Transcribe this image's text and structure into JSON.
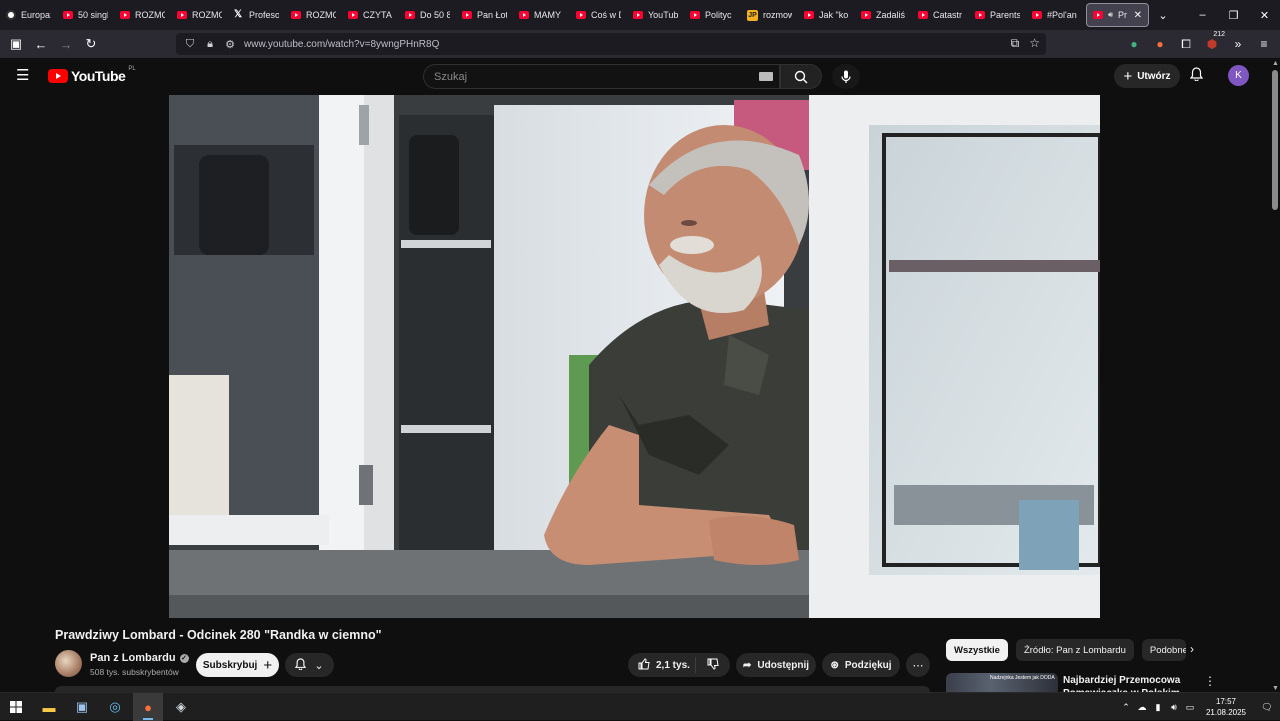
{
  "browser": {
    "tabs": [
      {
        "label": "Europa:",
        "icon": "globe-icon"
      },
      {
        "label": "50 singl",
        "icon": "youtube-icon"
      },
      {
        "label": "ROZMO",
        "icon": "youtube-icon"
      },
      {
        "label": "ROZMO",
        "icon": "youtube-icon"
      },
      {
        "label": "Profeso",
        "icon": "x-icon"
      },
      {
        "label": "ROZMO",
        "icon": "youtube-icon"
      },
      {
        "label": "CZYTA",
        "icon": "youtube-icon"
      },
      {
        "label": "Do 50 8",
        "icon": "youtube-icon"
      },
      {
        "label": "Pan Łot",
        "icon": "youtube-icon"
      },
      {
        "label": "MAMY",
        "icon": "youtube-icon"
      },
      {
        "label": "Coś w D",
        "icon": "youtube-icon"
      },
      {
        "label": "YouTub",
        "icon": "youtube-icon"
      },
      {
        "label": "Polityc",
        "icon": "youtube-icon"
      },
      {
        "label": "rozmow",
        "icon": "jp-icon"
      },
      {
        "label": "Jak \"ko",
        "icon": "youtube-icon"
      },
      {
        "label": "Zadaliś",
        "icon": "youtube-icon"
      },
      {
        "label": "Catastr",
        "icon": "youtube-icon"
      },
      {
        "label": "Parents",
        "icon": "youtube-icon"
      },
      {
        "label": "#Pol'an",
        "icon": "youtube-icon"
      }
    ],
    "active_tab": {
      "label": "Pra",
      "icon": "youtube-icon"
    },
    "url": "www.youtube.com/watch?v=8ywngPHnR8Q",
    "extension_badge": "212"
  },
  "youtube": {
    "logo_text": "YouTube",
    "country_code": "PL",
    "search_placeholder": "Szukaj",
    "create_label": "Utwórz",
    "avatar_letter": "K"
  },
  "video": {
    "title": "Prawdziwy Lombard - Odcinek 280 \"Randka w ciemno\"",
    "channel_name": "Pan z Lombardu",
    "subscribers": "508 tys. subskrybentów",
    "subscribe_label": "Subskrybuj",
    "likes": "2,1 tys.",
    "share_label": "Udostępnij",
    "thanks_label": "Podziękuj"
  },
  "sidebar": {
    "chips": [
      "Wszystkie",
      "Źródło: Pan z Lombardu",
      "Podobne"
    ],
    "reco_title": "Najbardziej Przemocowa Pomawiaczka w Polskim",
    "reco_thumb_text": "Nadzejnka  Jestem jak DODA"
  },
  "taskbar": {
    "time": "17:57",
    "date": "21.08.2025"
  },
  "colors": {
    "youtube_red": "#ff0000",
    "avatar_purple": "#7e57c2",
    "browser_chrome": "#1c1b22"
  }
}
